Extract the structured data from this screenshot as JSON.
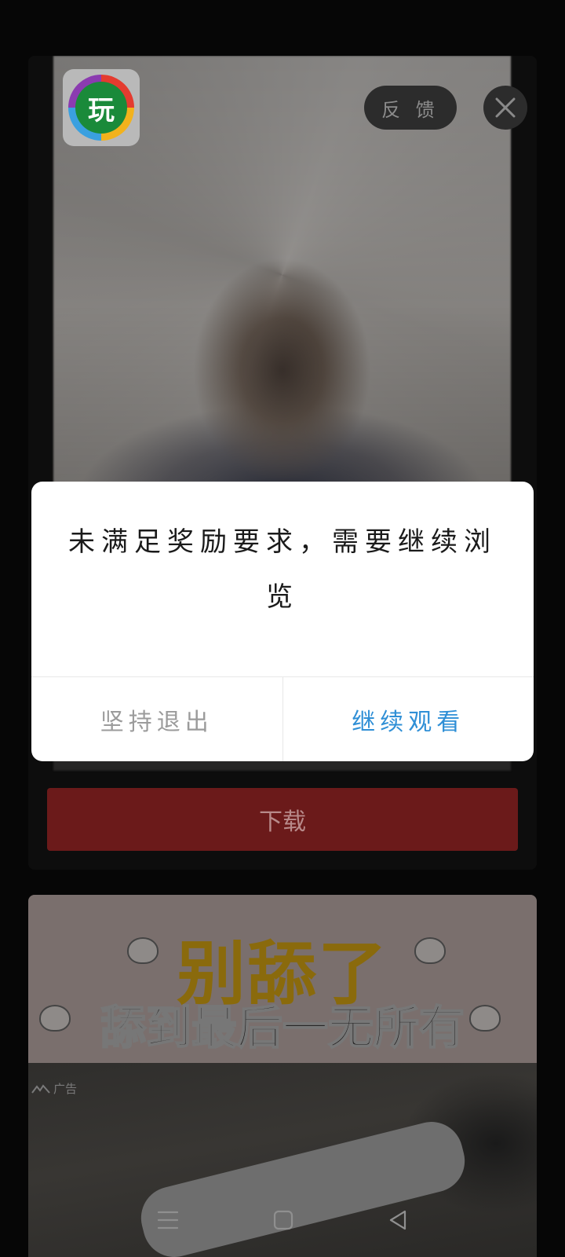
{
  "ad_card": {
    "app_logo_char": "玩",
    "feedback_label": "反 馈",
    "download_label": "下载"
  },
  "second_ad": {
    "banner_title": "别舔了",
    "banner_subtitle": "舔到最后一无所有",
    "ad_tag": "广告"
  },
  "dialog": {
    "message": "未满足奖励要求，需要继续浏览",
    "exit_label": "坚持退出",
    "continue_label": "继续观看"
  },
  "colors": {
    "continue_accent": "#2f8fd6",
    "download_bg": "#6b1a1a"
  },
  "icons": [
    "close-icon",
    "menu-nav-icon",
    "home-nav-icon",
    "back-nav-icon",
    "ad-logo-icon"
  ]
}
